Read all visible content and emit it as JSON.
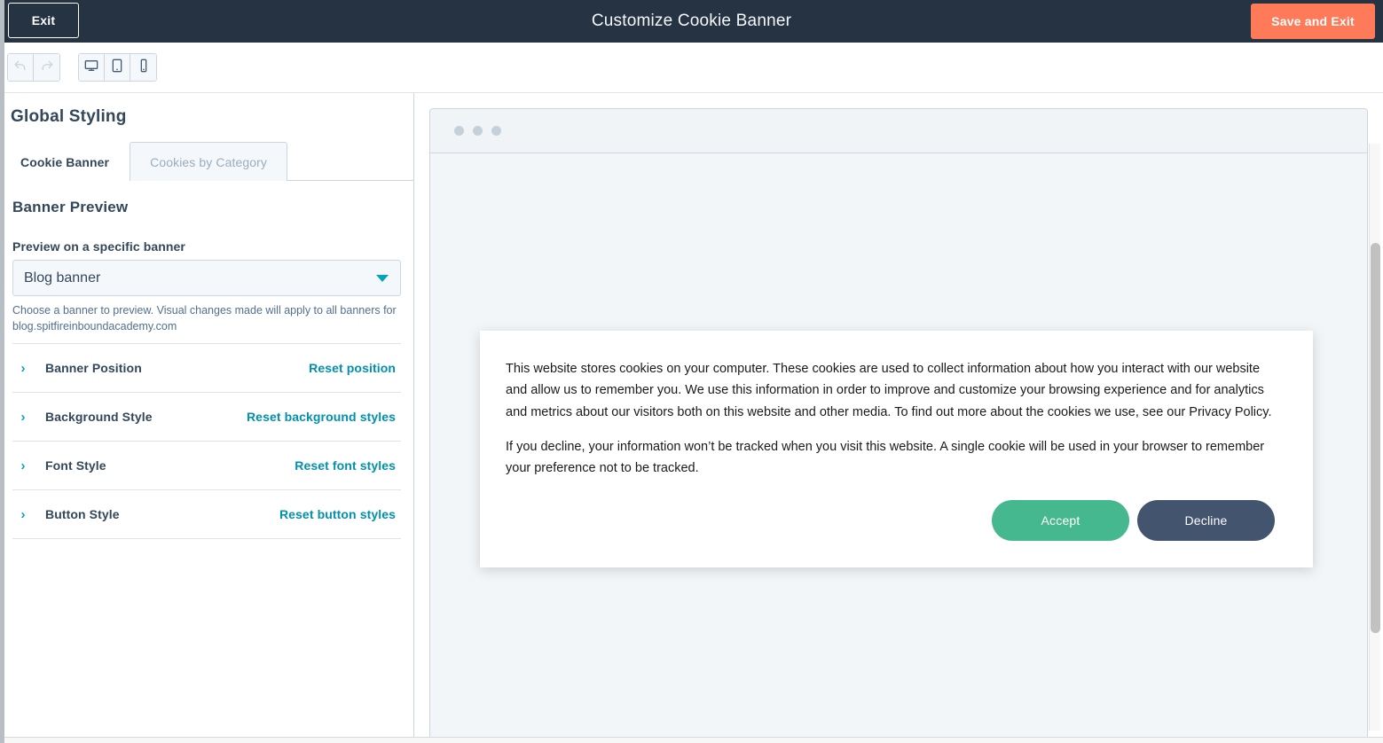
{
  "header": {
    "exit_label": "Exit",
    "title": "Customize Cookie Banner",
    "save_exit_label": "Save and Exit",
    "background_color": "#253342",
    "save_button_color": "#ff7a59"
  },
  "toolbar": {
    "history": [
      {
        "name": "undo-icon",
        "label": "Undo",
        "disabled": true
      },
      {
        "name": "redo-icon",
        "label": "Redo",
        "disabled": true
      }
    ],
    "devices": [
      {
        "name": "desktop-icon",
        "label": "Desktop",
        "active": true
      },
      {
        "name": "tablet-icon",
        "label": "Tablet",
        "active": false
      },
      {
        "name": "mobile-icon",
        "label": "Mobile",
        "active": false
      }
    ]
  },
  "sidebar": {
    "title": "Global Styling",
    "tabs": [
      {
        "label": "Cookie Banner",
        "active": true
      },
      {
        "label": "Cookies by Category",
        "active": false
      }
    ],
    "section_heading": "Banner Preview",
    "preview_select": {
      "label": "Preview on a specific banner",
      "value": "Blog banner",
      "caret_icon": "chevron-down-icon",
      "caret_color": "#00a4bd"
    },
    "helper_text": "Choose a banner to preview. Visual changes made will apply to all banners for blog.spitfireinboundacademy.com",
    "accordion": [
      {
        "chevron": "›",
        "label": "Banner Position",
        "reset_label": "Reset position"
      },
      {
        "chevron": "›",
        "label": "Background Style",
        "reset_label": "Reset background styles"
      },
      {
        "chevron": "›",
        "label": "Font Style",
        "reset_label": "Reset font styles"
      },
      {
        "chevron": "›",
        "label": "Button Style",
        "reset_label": "Reset button styles"
      }
    ],
    "link_color": "#0091ae"
  },
  "preview": {
    "chrome_dots": 3,
    "banner": {
      "paragraph_1": "This website stores cookies on your computer. These cookies are used to collect information about how you interact with our website and allow us to remember you. We use this information in order to improve and customize your browsing experience and for analytics and metrics about our visitors both on this website and other media. To find out more about the cookies we use, see our Privacy Policy.",
      "paragraph_2": "If you decline, your information won’t be tracked when you visit this website. A single cookie will be used in your browser to remember your preference not to be tracked.",
      "accept_label": "Accept",
      "decline_label": "Decline",
      "accept_color": "#46b88f",
      "decline_color": "#42546e"
    }
  }
}
